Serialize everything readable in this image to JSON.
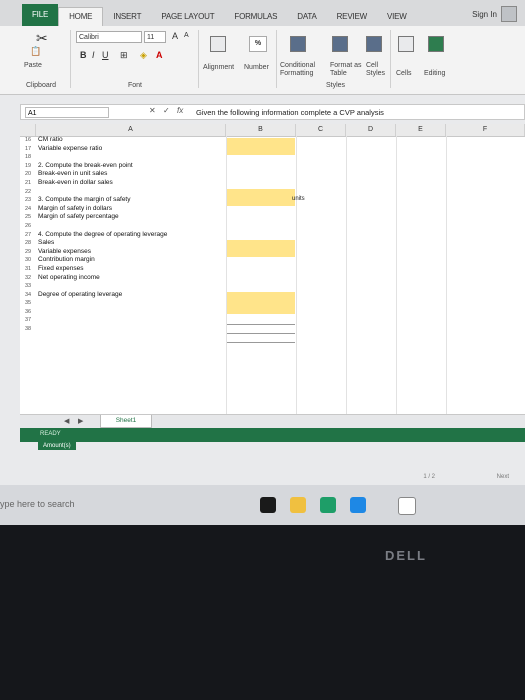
{
  "ribbon_tabs": [
    "FILE",
    "HOME",
    "INSERT",
    "PAGE LAYOUT",
    "FORMULAS",
    "DATA",
    "REVIEW",
    "VIEW"
  ],
  "sign_in": "Sign In",
  "ribbon": {
    "font_name": "Calibri",
    "font_size": "11",
    "paste": "Paste",
    "clipboard": "Clipboard",
    "font_group": "Font",
    "alignment": "Alignment",
    "number": "Number",
    "conditional": "Conditional Formatting",
    "format_table": "Format as Table",
    "cell_styles": "Cell Styles",
    "styles_group": "Styles",
    "cells": "Cells",
    "editing": "Editing",
    "percent": "%"
  },
  "formula_bar": {
    "name_box": "A1",
    "fx": "fx",
    "content": "Given the following information complete a CVP analysis"
  },
  "columns": [
    "A",
    "B",
    "C",
    "D",
    "E",
    "F"
  ],
  "rows": [
    {
      "num": "16",
      "text": "CM ratio"
    },
    {
      "num": "17",
      "text": "Variable expense ratio"
    },
    {
      "num": "18",
      "text": ""
    },
    {
      "num": "19",
      "text": "2. Compute the break-even point"
    },
    {
      "num": "20",
      "text": "Break-even in unit sales"
    },
    {
      "num": "21",
      "text": "Break-even in dollar sales"
    },
    {
      "num": "22",
      "text": ""
    },
    {
      "num": "23",
      "text": "3. Compute the margin of safety"
    },
    {
      "num": "24",
      "text": "Margin of safety in dollars"
    },
    {
      "num": "25",
      "text": "Margin of safety percentage"
    },
    {
      "num": "26",
      "text": ""
    },
    {
      "num": "27",
      "text": "4. Compute the degree of operating leverage"
    },
    {
      "num": "28",
      "text": "Sales"
    },
    {
      "num": "29",
      "text": "Variable expenses"
    },
    {
      "num": "30",
      "text": "Contribution margin"
    },
    {
      "num": "31",
      "text": "Fixed expenses"
    },
    {
      "num": "32",
      "text": "Net operating income"
    },
    {
      "num": "33",
      "text": ""
    },
    {
      "num": "34",
      "text": "Degree of operating leverage"
    },
    {
      "num": "35",
      "text": ""
    },
    {
      "num": "36",
      "text": ""
    },
    {
      "num": "37",
      "text": ""
    },
    {
      "num": "38",
      "text": ""
    }
  ],
  "units_label": "units",
  "sheet_tab": "Sheet1",
  "status": "READY",
  "amount_chip": "Amount(s)",
  "pager": "1 / 2",
  "next": "Next",
  "taskbar_search": "ype here to search",
  "brand": "DELL"
}
